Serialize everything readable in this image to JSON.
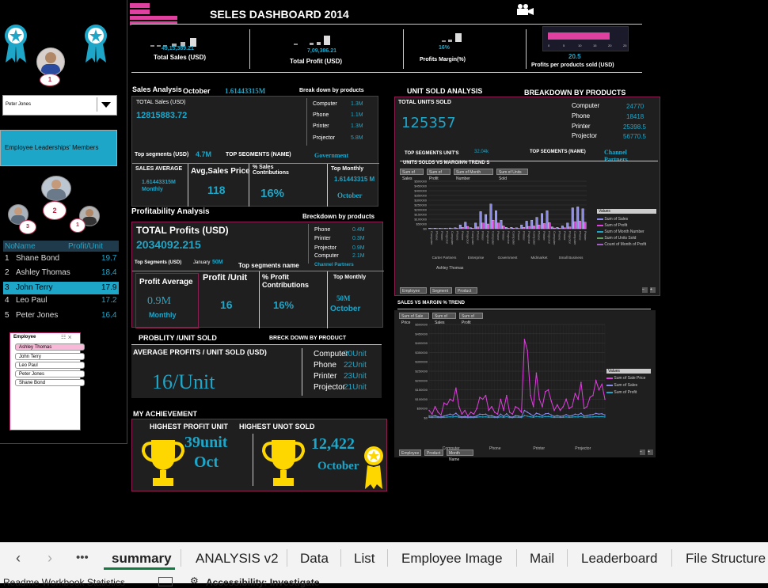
{
  "dashboard": {
    "title": "SELES DASHBOARD  2014",
    "kpi": {
      "total_sales_value": "49,15,389.21",
      "total_sales_label": "Total Sales (USD)",
      "total_profit_value": "7,09,386.21",
      "total_profit_label": "Total Profit (USD)",
      "profit_margin_value": "16%",
      "profit_margin_label": "Profits Margin(%)",
      "profit_per_unit_value": "20.5",
      "profit_per_unit_label": "Profits per products sold (USD)",
      "ticks": [
        "0",
        "5",
        "10",
        "15",
        "20",
        "25"
      ],
      "profit_per_unit_bar": 20.5
    }
  },
  "left": {
    "selected_employee": "Peter Jones",
    "members_label": "Employee Leaderships' Members",
    "ranks": [
      "1",
      "2",
      "3",
      "1"
    ],
    "leaderboard": {
      "col_no": "No",
      "col_name": "Name",
      "col_profit": "Profit/Unit",
      "rows": [
        {
          "no": "1",
          "name": "Shane Bond",
          "profit": "19.7"
        },
        {
          "no": "2",
          "name": "Ashley Thomas",
          "profit": "18.4"
        },
        {
          "no": "3",
          "name": "John Terry",
          "profit": "17.9"
        },
        {
          "no": "4",
          "name": "Leo Paul",
          "profit": "17.2"
        },
        {
          "no": "5",
          "name": "Peter Jones",
          "profit": "16.4"
        }
      ]
    },
    "slicer": {
      "title": "Employee",
      "items": [
        "Ashley Thomas",
        "John Terry",
        "Leo Paul",
        "Peter Jones",
        "Shane Bond"
      ]
    }
  },
  "sales_analysis": {
    "title": "Sales Analysis",
    "month": "October",
    "month_value": "1.61443315M",
    "breakdown_label": "Break down by products",
    "total_sales_label": "TOTAL Sales (USD)",
    "total_sales_value": "12815883.72",
    "products": [
      {
        "name": "Computer",
        "value": "1.3M"
      },
      {
        "name": "Phone",
        "value": "1.1M"
      },
      {
        "name": "Printer",
        "value": "1.3M"
      },
      {
        "name": "Projector",
        "value": "5.8M"
      }
    ],
    "top_segments_label": "Top segments (USD)",
    "top_segments_value": "4.7M",
    "top_segments_name_label": "TOP SEGMENTS (NAME)",
    "top_segments_name": "Government",
    "sales_average_label": "SALES AVERAGE",
    "sales_average_value": "1.61443315M",
    "sales_average_period": "Monthly",
    "avg_price_label": "Avg,Sales Price",
    "avg_price_value": "118",
    "contrib_label": "% Sales Contributions",
    "contrib_value": "16%",
    "top_monthly_label": "Top Monthly",
    "top_monthly_value": "1.61443315 M",
    "top_monthly_month": "October"
  },
  "profitability": {
    "title": "Profitability Analysis",
    "breakdown_label": "Breckdown by products",
    "total_label": "TOTAL  Profits  (USD)",
    "total_value": "2034092.215",
    "products": [
      {
        "name": "Phone",
        "value": "0.4M"
      },
      {
        "name": "Printer",
        "value": "0.3M"
      },
      {
        "name": "Projector",
        "value": "0.9M"
      },
      {
        "name": "Computer",
        "value": "2.1M"
      }
    ],
    "top_segments_label": "Top Segments (USD)",
    "top_segments_month": "January",
    "top_segments_value": "50M",
    "top_segments_name_label": "Top segments  name",
    "top_segments_name": "Channel Partners",
    "avg_label": "Profit Average",
    "avg_value": "0.9M",
    "avg_period": "Monthly",
    "per_unit_label": "Profit /Unit",
    "per_unit_value": "16",
    "contrib_label": "% Profit Contributions",
    "contrib_value": "16%",
    "top_monthly_label": "Top Monthly",
    "top_monthly_value": "50M",
    "top_monthly_month": "October"
  },
  "per_unit": {
    "title": "PROBLITY /UNIT SOLD",
    "breakdown_label": "BRECK DOWN BY PRODUCT",
    "avg_label": "AVERAGE  PROFITS / UNIT SOLD (USD)",
    "avg_value": "16/Unit",
    "products": [
      {
        "name": "Computer",
        "value": "20Unit"
      },
      {
        "name": "Phone",
        "value": "22Unit"
      },
      {
        "name": "Printer",
        "value": "23Unit"
      },
      {
        "name": "Projector",
        "value": "21Unit"
      }
    ]
  },
  "achievement": {
    "title": "MY ACHIEVEMENT",
    "highest_profit_label": "HIGHEST PROFIT UNIT",
    "highest_profit_value": "39unit",
    "highest_profit_month": "Oct",
    "highest_sold_label": "HIGHEST UNOT SOLD",
    "highest_sold_value": "12,422",
    "highest_sold_month": "October"
  },
  "unit_sold": {
    "title": "UNIT SOLD ANALYSIS",
    "breakdown_label": "BREAKDOWN BY PRODUCTS",
    "total_label": "TOTAL  UNITS SOLD",
    "total_value": "125357",
    "products": [
      {
        "name": "Computer",
        "value": "24770"
      },
      {
        "name": "Phone",
        "value": "18418"
      },
      {
        "name": "Printer",
        "value": "25398.5"
      },
      {
        "name": "Projector",
        "value": "56770.5"
      }
    ],
    "top_segments_label": "TOP SEGMENTS UNIT'S",
    "top_segments_value": "32.04k",
    "top_segments_name_label": "TOP SEGMENTS (NAME)",
    "top_segments_name": "Channel Partners",
    "chart_title": "UNITS SOLDS VS MARGIN% TREND S",
    "field_buttons": [
      "Sum of Sales",
      "Sum of Profit",
      "Sum of Month Number",
      "Sum of Units Sold"
    ],
    "filter_buttons": [
      "Employee",
      "Segment",
      "Product"
    ],
    "legend_title": "Values",
    "legend_items": [
      "Sum of Sales",
      "Sum of Profit",
      "Sum of Month Number",
      "Sum of Units Sold",
      "Count of Month of Profit"
    ]
  },
  "trend": {
    "title": "SALES VS MARGIN % TREND",
    "field_buttons": [
      "Sum of Sale Price",
      "Sum of Sales",
      "Sum of Profit"
    ],
    "filter_buttons": [
      "Employee",
      "Product",
      "Month Name"
    ],
    "legend_title": "Values",
    "legend_items": [
      "Sum of Sale Price",
      "Sum of Sales",
      "Sum of Profit"
    ],
    "product_labels": [
      "Computer",
      "Phone",
      "Printer",
      "Projector"
    ]
  },
  "chart_data": [
    {
      "type": "bar",
      "title": "UNITS SOLDS VS MARGIN% TREND S",
      "y_ticks": [
        "$500000",
        "$450000",
        "$400000",
        "$350000",
        "$300000",
        "$250000",
        "$200000",
        "$150000",
        "$100000",
        "$50000",
        "$0"
      ],
      "ylim": [
        0,
        500000
      ],
      "group_labels": [
        "Carter Partners",
        "Enterprise",
        "Government",
        "Midmarket",
        "Small Business"
      ],
      "group_sub_label": "Ashley Thomas",
      "series": [
        {
          "name": "Sum of Sales",
          "color": "#8a8aee",
          "values": [
            5000,
            6000,
            5000,
            5000,
            8000,
            10000,
            40000,
            70000,
            12000,
            60000,
            180000,
            150000,
            260000,
            190000,
            90000,
            14000,
            15000,
            10000,
            40000,
            80000,
            90000,
            120000,
            160000,
            190000,
            20000,
            15000,
            30000,
            60000,
            220000,
            230000,
            210000
          ]
        },
        {
          "name": "Sum of Profit",
          "color": "#e040e0",
          "values": [
            2000,
            2500,
            2000,
            2000,
            3000,
            4000,
            15000,
            25000,
            5000,
            20000,
            60000,
            50000,
            90000,
            60000,
            30000,
            5000,
            6000,
            4000,
            15000,
            25000,
            30000,
            40000,
            55000,
            65000,
            8000,
            6000,
            10000,
            20000,
            75000,
            80000,
            70000
          ]
        }
      ]
    },
    {
      "type": "line",
      "title": "SALES VS MARGIN % TREND",
      "y_ticks": [
        "$500000",
        "$450000",
        "$400000",
        "$350000",
        "$300000",
        "$250000",
        "$200000",
        "$150000",
        "$100000",
        "$50000",
        "$0"
      ],
      "ylim": [
        0,
        500000
      ],
      "categories_groups": [
        "Computer",
        "Phone",
        "Printer",
        "Projector"
      ],
      "series": [
        {
          "name": "Sum of Sale Price",
          "color": "#e040e0",
          "values": [
            40000,
            20000,
            60000,
            30000,
            15000,
            80000,
            70000,
            100000,
            90000,
            160000,
            60000,
            20000,
            40000,
            10000,
            30000,
            20000,
            50000,
            110000,
            100000,
            120000,
            40000,
            60000,
            30000,
            20000,
            100000,
            40000,
            120000,
            30000,
            20000,
            60000,
            50000,
            30000,
            420000,
            360000,
            120000,
            60000,
            240000,
            100000,
            60000,
            140000,
            150000,
            90000,
            40000,
            70000,
            40000,
            60000,
            100000,
            50000,
            60000,
            130000,
            100000,
            190000,
            50000,
            60000,
            110000,
            120000,
            200000,
            150000,
            180000,
            100000
          ]
        },
        {
          "name": "Sum of Sales",
          "color": "#8a8aee",
          "values": [
            10000,
            8000,
            12000,
            6000,
            5000,
            10000,
            14000,
            20000,
            15000,
            25000,
            10000,
            5000,
            8000,
            4000,
            6000,
            5000,
            10000,
            20000,
            18000,
            20000,
            10000,
            12000,
            6000,
            5000,
            20000,
            8000,
            22000,
            6000,
            4000,
            12000,
            10000,
            6000,
            40000,
            30000,
            20000,
            10000,
            25000,
            20000,
            12000,
            22000,
            24000,
            15000,
            8000,
            12000,
            8000,
            10000,
            18000,
            10000,
            12000,
            20000,
            16000,
            25000,
            10000,
            12000,
            16000,
            18000,
            24000,
            20000,
            22000,
            15000
          ]
        },
        {
          "name": "Sum of Profit",
          "color": "#1ea6c9",
          "values": [
            3000,
            2000,
            4000,
            2000,
            1500,
            3000,
            4000,
            6000,
            5000,
            8000,
            3000,
            1500,
            2500,
            1200,
            2000,
            1500,
            3000,
            6000,
            5000,
            6000,
            3000,
            4000,
            2000,
            1500,
            6000,
            2500,
            7000,
            2000,
            1200,
            4000,
            3000,
            2000,
            12000,
            9000,
            6000,
            3000,
            8000,
            6000,
            4000,
            7000,
            7500,
            5000,
            2500,
            4000,
            2500,
            3000,
            5500,
            3000,
            4000,
            6000,
            5000,
            8000,
            3000,
            4000,
            5000,
            5500,
            7500,
            6000,
            7000,
            5000
          ]
        }
      ]
    }
  ],
  "tabs": {
    "items": [
      "summary",
      "ANALYSIS v2",
      "Data",
      "List",
      "Employee Image",
      "Mail",
      "Leaderboard",
      "File Structure"
    ],
    "active": "summary"
  },
  "status": {
    "left": "Readme Workbook Statistics",
    "accessibility": "Accessibility: Investigate"
  }
}
